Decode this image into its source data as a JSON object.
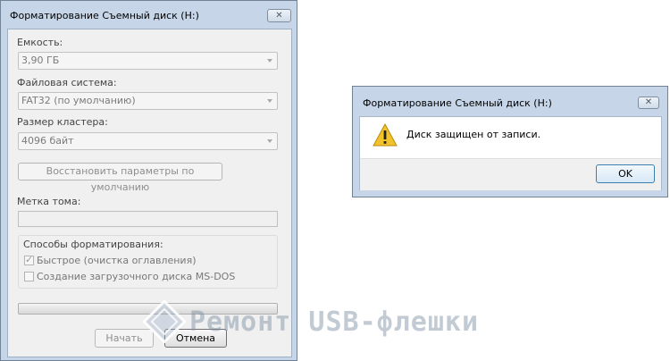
{
  "format_window": {
    "title": "Форматирование Съемный диск (H:)",
    "close_glyph": "✕",
    "capacity": {
      "label": "Емкость:",
      "value": "3,90 ГБ"
    },
    "filesystem": {
      "label": "Файловая система:",
      "value": "FAT32 (по умолчанию)"
    },
    "cluster": {
      "label": "Размер кластера:",
      "value": "4096 байт"
    },
    "restore_defaults_label": "Восстановить параметры по умолчанию",
    "volume_label": {
      "label": "Метка тома:",
      "value": ""
    },
    "format_options": {
      "title": "Способы форматирования:",
      "quick": {
        "label": "Быстрое (очистка оглавления)",
        "checked": true
      },
      "msdos": {
        "label": "Создание загрузочного диска MS-DOS",
        "checked": false
      }
    },
    "progress": 0,
    "start_label": "Начать",
    "cancel_label": "Отмена"
  },
  "message_box": {
    "title": "Форматирование Съемный диск (H:)",
    "close_glyph": "✕",
    "icon": "warning-icon",
    "message": "Диск защищен от записи.",
    "ok_label": "OK"
  },
  "watermark": {
    "text": "Ремонт USB-флешки",
    "icon": "usb-logo"
  },
  "colors": {
    "window_frame": "#c6d6e8",
    "client_bg": "#f0f0f0",
    "warning": "#f2c22b",
    "ok_border": "#3c7fb1"
  }
}
